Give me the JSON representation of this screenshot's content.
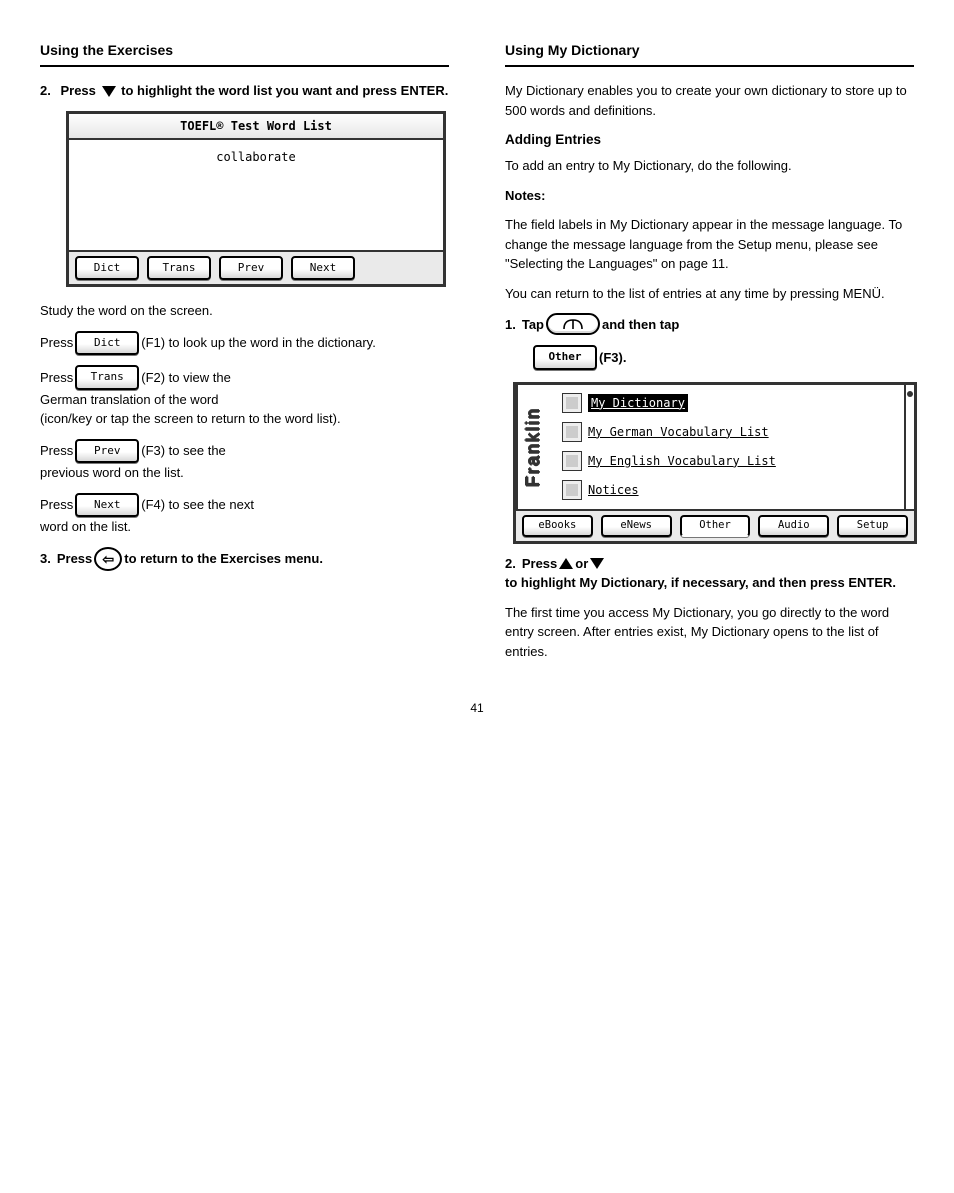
{
  "left": {
    "title": "Using the Exercises",
    "step2": {
      "num": "2.",
      "text_before": "Press ",
      "text_after": " to highlight the word list you want and press",
      "enter": " ENTER",
      "trail": "."
    },
    "screenshot1": {
      "title": "TOEFL® Test Word List",
      "word": "collaborate",
      "buttons": [
        "Dict",
        "Trans",
        "Prev",
        "Next"
      ]
    },
    "study_line_before": "Study the word on the screen.",
    "dict_para_before": "Press ",
    "dict_btn": "Dict",
    "dict_para_after": " (F1) to look up the word in the dictionary.",
    "trans_btn": "Trans",
    "trans_para_before": "Press ",
    "trans_para_after": " (F2) to view the",
    "trans_line2": "German translation of the word",
    "trans_line3": "(icon/key or tap the screen to return to the word list).",
    "prev_btn": "Prev",
    "prev_para_before": "Press ",
    "prev_para_after": " (F3) to see the",
    "prev_line2": "previous word on the list.",
    "next_btn": "Next",
    "next_para_before": "Press ",
    "next_para_after": " (F4) to see the next",
    "next_line2": "word on the list.",
    "step3": {
      "num": "3.",
      "before": "Press ",
      "after": " to return to the Exercises menu."
    }
  },
  "right": {
    "title": "Using My Dictionary",
    "intro1": "My Dictionary enables you to create your own dictionary to store up to 500 words and definitions.",
    "addHead": "Adding Entries",
    "intro2": "To add an entry to My Dictionary, do the following.",
    "note_head": "Notes:",
    "notes": [
      "The field labels in My Dictionary appear in the message language. To change the message language from the Setup menu, please see \"Selecting the Languages\" on page 11.",
      "You can return to the list of entries at any time by pressing MENÜ."
    ],
    "step1": {
      "num": "1.",
      "text": "Tap ",
      "mid": " and then tap",
      "other_btn": "Other",
      "after": " (F3)."
    },
    "screenshot2": {
      "brand": "Franklin",
      "items": [
        {
          "label": "My Dictionary",
          "selected": true
        },
        {
          "label": "My German Vocabulary List",
          "selected": false
        },
        {
          "label": "My English Vocabulary List",
          "selected": false
        },
        {
          "label": "Notices",
          "selected": false
        }
      ],
      "tabs": [
        "eBooks",
        "eNews",
        "Other",
        "Audio",
        "Setup"
      ],
      "activeTab": 2
    },
    "step2": {
      "num": "2.",
      "before": "Press ",
      "mid": " or ",
      "after": " to highlight My Dictionary, if necessary, and then press ENTER."
    },
    "afterStep2": "The first time you access My Dictionary, you go directly to the word entry screen. After entries exist, My Dictionary opens to the list of entries."
  },
  "pageNum": "41"
}
